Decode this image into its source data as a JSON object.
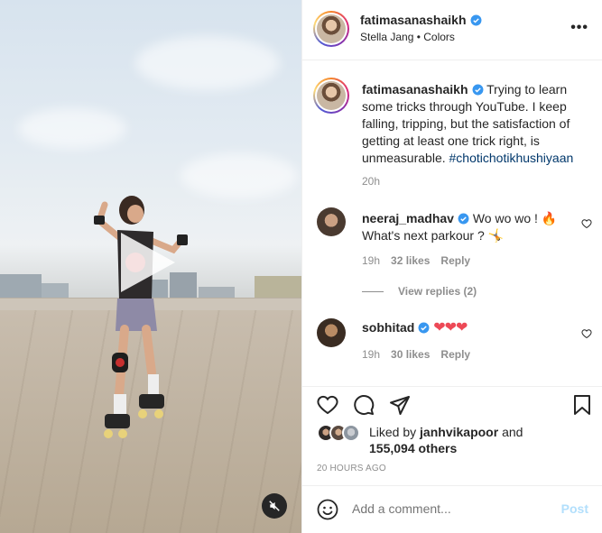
{
  "post": {
    "author": "fatimasanashaikh",
    "audio": "Stella Jang • Colors",
    "caption": "Trying to learn some tricks through YouTube. I keep falling, tripping, but the satisfaction of getting at least one trick right, is unmeasurable.",
    "hashtag": "#chotichotikhushiyaan",
    "caption_time": "20h",
    "more_icon": "more-options-icon"
  },
  "comments": [
    {
      "username": "neeraj_madhav",
      "text_line1": "Wo wo wo ! 🔥",
      "text_line2": "What's next parkour ? 🤸",
      "time": "19h",
      "likes": "32 likes",
      "reply": "Reply",
      "view_replies": "View replies (2)"
    },
    {
      "username": "sobhitad",
      "text": "❤❤❤",
      "time": "19h",
      "likes": "30 likes",
      "reply": "Reply"
    }
  ],
  "engagement": {
    "liked_by_prefix": "Liked by",
    "liked_by_user": "janhvikapoor",
    "and": "and",
    "others_count": "155,094 others",
    "date": "20 HOURS AGO"
  },
  "composer": {
    "placeholder": "Add a comment...",
    "post_label": "Post"
  },
  "colors": {
    "link": "#00376b",
    "secondary": "#8e8e8e",
    "verified": "#3897f0",
    "post_disabled": "#b2dffc",
    "heart_red": "#ed4956"
  }
}
